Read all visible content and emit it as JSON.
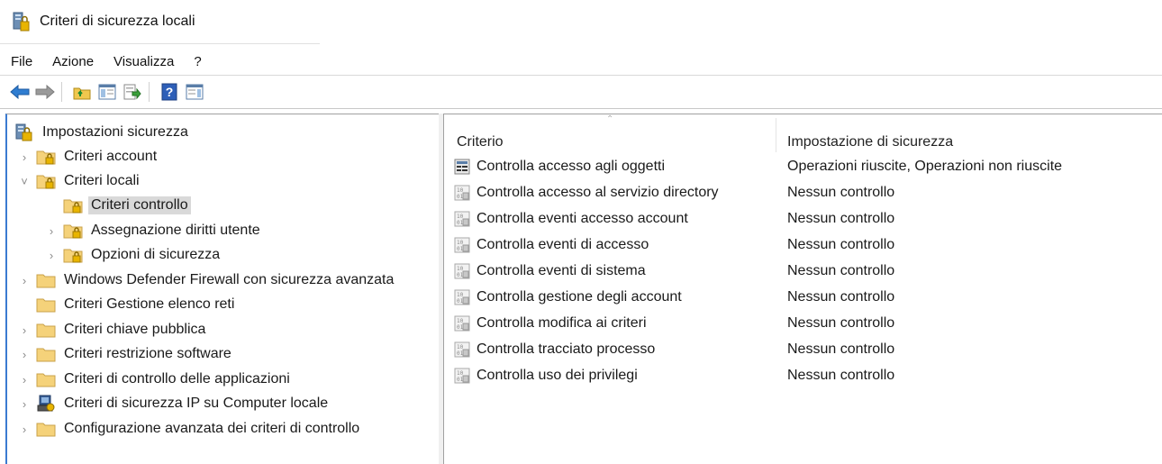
{
  "window": {
    "title": "Criteri di sicurezza locali",
    "icon": "security-policy-icon"
  },
  "menubar": {
    "items": [
      "File",
      "Azione",
      "Visualizza",
      "?"
    ]
  },
  "toolbar": {
    "buttons": [
      "back-arrow-icon",
      "forward-arrow-icon",
      "up-folder-icon",
      "show-hide-tree-icon",
      "export-list-icon",
      "help-icon",
      "properties-pane-icon"
    ]
  },
  "tree": {
    "items": [
      {
        "label": "Impostazioni sicurezza",
        "icon": "security-settings-icon",
        "expander": "",
        "level": 0
      },
      {
        "label": "Criteri account",
        "icon": "lock-folder-icon",
        "expander": "›",
        "level": 1
      },
      {
        "label": "Criteri locali",
        "icon": "lock-folder-icon",
        "expander": "˅",
        "level": 1
      },
      {
        "label": "Criteri controllo",
        "icon": "lock-folder-icon",
        "expander": "",
        "level": 2,
        "selected": true
      },
      {
        "label": "Assegnazione diritti utente",
        "icon": "lock-folder-icon",
        "expander": "›",
        "level": 2
      },
      {
        "label": "Opzioni di sicurezza",
        "icon": "lock-folder-icon",
        "expander": "›",
        "level": 2
      },
      {
        "label": "Windows Defender Firewall con sicurezza avanzata",
        "icon": "folder-icon",
        "expander": "›",
        "level": 1
      },
      {
        "label": "Criteri Gestione elenco reti",
        "icon": "folder-icon",
        "expander": "",
        "level": 1
      },
      {
        "label": "Criteri chiave pubblica",
        "icon": "folder-icon",
        "expander": "›",
        "level": 1
      },
      {
        "label": "Criteri restrizione software",
        "icon": "folder-icon",
        "expander": "›",
        "level": 1
      },
      {
        "label": "Criteri di controllo delle applicazioni",
        "icon": "folder-icon",
        "expander": "›",
        "level": 1
      },
      {
        "label": "Criteri di sicurezza IP su Computer locale",
        "icon": "ip-security-icon",
        "expander": "›",
        "level": 1
      },
      {
        "label": "Configurazione avanzata dei criteri di controllo",
        "icon": "folder-icon",
        "expander": "›",
        "level": 1
      }
    ]
  },
  "list": {
    "columns": [
      "Criterio",
      "Impostazione di sicurezza"
    ],
    "rows": [
      {
        "name": "Controlla accesso agli oggetti",
        "value": "Operazioni riuscite, Operazioni non riuscite",
        "icon": "policy-active-icon"
      },
      {
        "name": "Controlla accesso al servizio directory",
        "value": "Nessun controllo",
        "icon": "policy-icon"
      },
      {
        "name": "Controlla eventi accesso account",
        "value": "Nessun controllo",
        "icon": "policy-icon"
      },
      {
        "name": "Controlla eventi di accesso",
        "value": "Nessun controllo",
        "icon": "policy-icon"
      },
      {
        "name": "Controlla eventi di sistema",
        "value": "Nessun controllo",
        "icon": "policy-icon"
      },
      {
        "name": "Controlla gestione degli account",
        "value": "Nessun controllo",
        "icon": "policy-icon"
      },
      {
        "name": "Controlla modifica ai criteri",
        "value": "Nessun controllo",
        "icon": "policy-icon"
      },
      {
        "name": "Controlla tracciato processo",
        "value": "Nessun controllo",
        "icon": "policy-icon"
      },
      {
        "name": "Controlla uso dei privilegi",
        "value": "Nessun controllo",
        "icon": "policy-icon"
      }
    ]
  },
  "colors": {
    "selection": "#d9d9d9",
    "accent": "#3b7ad1",
    "folder": "#f5d27a",
    "lock": "#e0a400"
  }
}
